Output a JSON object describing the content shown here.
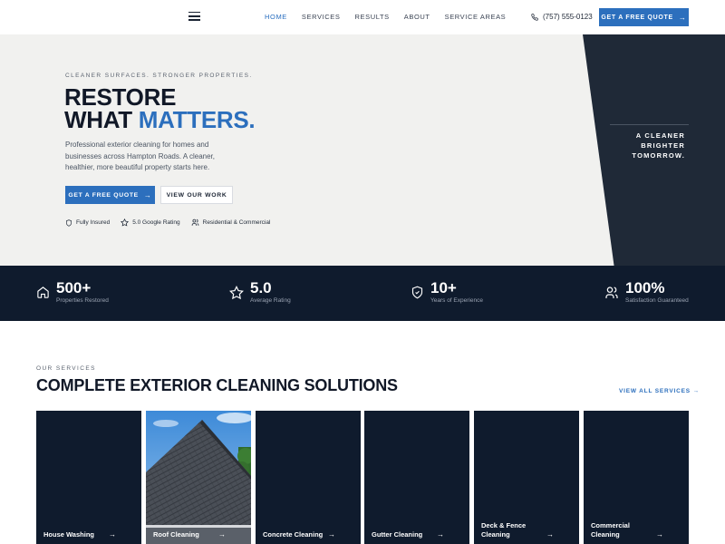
{
  "header": {
    "nav": [
      "HOME",
      "SERVICES",
      "RESULTS",
      "ABOUT",
      "SERVICE AREAS"
    ],
    "phone": "(757) 555-0123",
    "cta": "GET A FREE QUOTE"
  },
  "hero": {
    "kicker": "CLEANER SURFACES. STRONGER PROPERTIES.",
    "title_line1": "RESTORE",
    "title_line2_a": "WHAT ",
    "title_line2_b": "MATTERS.",
    "description": "Professional exterior cleaning for homes and businesses across Hampton Roads. A cleaner, healthier, more beautiful property starts here.",
    "primary_button": "GET A FREE QUOTE",
    "secondary_button": "VIEW OUR WORK",
    "badges": [
      "Fully Insured",
      "5.0 Google Rating",
      "Residential & Commercial"
    ],
    "side_text": [
      "A CLEANER",
      "BRIGHTER",
      "TOMORROW."
    ]
  },
  "stats": [
    {
      "value": "500+",
      "label": "Properties Restored",
      "icon": "home-icon"
    },
    {
      "value": "5.0",
      "label": "Average Rating",
      "icon": "star-icon"
    },
    {
      "value": "10+",
      "label": "Years of Experience",
      "icon": "shield-check-icon"
    },
    {
      "value": "100%",
      "label": "Satisfaction Guaranteed",
      "icon": "users-icon"
    }
  ],
  "services": {
    "kicker": "OUR SERVICES",
    "title": "COMPLETE EXTERIOR CLEANING SOLUTIONS",
    "view_all": "VIEW ALL SERVICES",
    "cards": [
      {
        "label": "House Washing"
      },
      {
        "label": "Roof Cleaning"
      },
      {
        "label": "Concrete Cleaning"
      },
      {
        "label": "Gutter Cleaning"
      },
      {
        "label": "Deck & Fence Cleaning"
      },
      {
        "label": "Commercial Cleaning"
      }
    ]
  },
  "colors": {
    "accent": "#2c6fbd",
    "navy": "#0f1b2d",
    "hero_bg": "#f1f1ef"
  }
}
